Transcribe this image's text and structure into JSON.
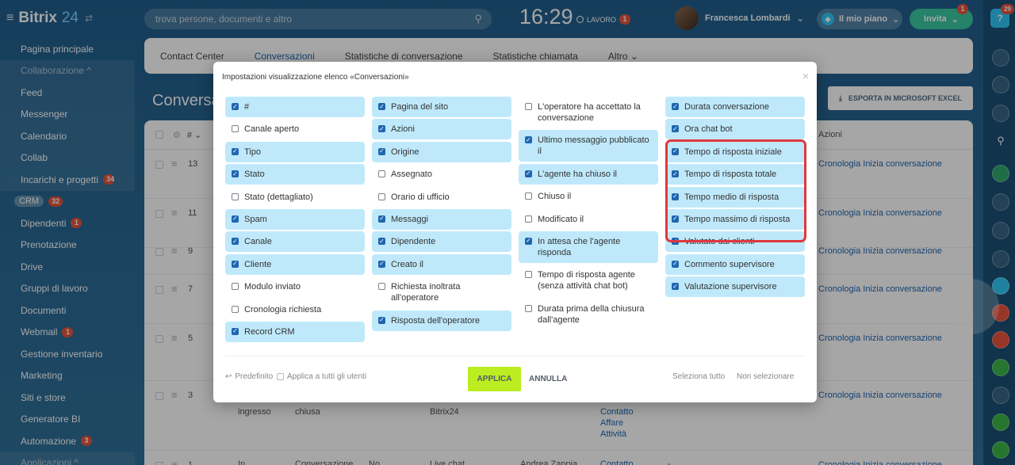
{
  "topbar": {
    "brand_main": "Bitrix",
    "brand_num": "24",
    "search_placeholder": "trova persone, documenti e altro",
    "clock": "16:29",
    "work_label": "LAVORO",
    "work_badge": "1",
    "user_name": "Francesca Lombardi",
    "plan_label": "Il mio piano",
    "invite_label": "Invita",
    "invite_badge": "1",
    "help_badge": "29"
  },
  "sidebar": {
    "items": [
      {
        "label": "Pagina principale"
      },
      {
        "label": "Collaborazione ^"
      },
      {
        "label": "Feed"
      },
      {
        "label": "Messenger"
      },
      {
        "label": "Calendario"
      },
      {
        "label": "Collab"
      },
      {
        "label": "Incarichi e progetti",
        "badge": "34"
      },
      {
        "label": "CRM",
        "badge": "32"
      },
      {
        "label": "Dipendenti",
        "badge": "1"
      },
      {
        "label": "Prenotazione"
      },
      {
        "label": "Drive"
      },
      {
        "label": "Gruppi di lavoro"
      },
      {
        "label": "Documenti"
      },
      {
        "label": "Webmail",
        "badge": "1"
      },
      {
        "label": "Gestione inventario"
      },
      {
        "label": "Marketing"
      },
      {
        "label": "Siti e store"
      },
      {
        "label": "Generatore BI"
      },
      {
        "label": "Automazione",
        "badge": "3"
      },
      {
        "label": "Applicazioni ^"
      }
    ]
  },
  "tabs": [
    "Contact Center",
    "Conversazioni",
    "Statistiche di conversazione",
    "Statistiche chiamata",
    "Altro ⌄"
  ],
  "page": {
    "title": "Conversa",
    "excel_button": "ESPORTA IN MICROSOFT EXCEL",
    "header_col_num": "# ⌄",
    "header_col_actions": "Azioni",
    "row_actions": "Cronologia Inizia conversazione",
    "rows": [
      {
        "num": "13"
      },
      {
        "num": "11"
      },
      {
        "num": "9"
      },
      {
        "num": "7"
      },
      {
        "num": "5"
      },
      {
        "num": "3",
        "c1": "ingresso",
        "c2": "chiusa",
        "c4": "Bitrix24",
        "links": "Contatto\nAffare\nAttività"
      },
      {
        "num": "1",
        "c1": "In",
        "c2": "Conversazione",
        "c3": "No",
        "c4": "Live chat",
        "c5": "Andrea Zappia",
        "links": "Contatto",
        "dash": "-"
      }
    ]
  },
  "modal": {
    "title": "Impostazioni visualizzazione elenco «Conversazioni»",
    "columns": [
      [
        {
          "label": "#",
          "checked": true
        },
        {
          "label": "Canale aperto",
          "checked": false
        },
        {
          "label": "Tipo",
          "checked": true
        },
        {
          "label": "Stato",
          "checked": true
        },
        {
          "label": "Stato (dettagliato)",
          "checked": false
        },
        {
          "label": "Spam",
          "checked": true
        },
        {
          "label": "Canale",
          "checked": true
        },
        {
          "label": "Cliente",
          "checked": true
        },
        {
          "label": "Modulo inviato",
          "checked": false
        },
        {
          "label": "Cronologia richiesta",
          "checked": false
        },
        {
          "label": "Record CRM",
          "checked": true
        }
      ],
      [
        {
          "label": "Pagina del sito",
          "checked": true
        },
        {
          "label": "Azioni",
          "checked": true
        },
        {
          "label": "Origine",
          "checked": true
        },
        {
          "label": "Assegnato",
          "checked": false
        },
        {
          "label": "Orario di ufficio",
          "checked": false
        },
        {
          "label": "Messaggi",
          "checked": true
        },
        {
          "label": "Dipendente",
          "checked": true
        },
        {
          "label": "Creato il",
          "checked": true
        },
        {
          "label": "Richiesta inoltrata all'operatore",
          "checked": false
        },
        {
          "label": "Risposta dell'operatore",
          "checked": true
        }
      ],
      [
        {
          "label": "L'operatore ha accettato la conversazione",
          "checked": false
        },
        {
          "label": "Ultimo messaggio pubblicato il",
          "checked": true
        },
        {
          "label": "L'agente ha chiuso il",
          "checked": true
        },
        {
          "label": "Chiuso il",
          "checked": false
        },
        {
          "label": "Modificato il",
          "checked": false
        },
        {
          "label": "In attesa che l'agente risponda",
          "checked": true
        },
        {
          "label": "Tempo di risposta agente (senza attività chat bot)",
          "checked": false
        },
        {
          "label": "Durata prima della chiusura dall'agente",
          "checked": false
        }
      ],
      [
        {
          "label": "Durata conversazione",
          "checked": true
        },
        {
          "label": "Ora chat bot",
          "checked": true
        },
        {
          "label": "Tempo di risposta iniziale",
          "checked": true
        },
        {
          "label": "Tempo di risposta totale",
          "checked": true
        },
        {
          "label": "Tempo medio di risposta",
          "checked": true
        },
        {
          "label": "Tempo massimo di risposta",
          "checked": true
        },
        {
          "label": "Valutato dai clienti",
          "checked": true
        },
        {
          "label": "Commento supervisore",
          "checked": true
        },
        {
          "label": "Valutazione supervisore",
          "checked": true
        }
      ]
    ],
    "default_label": "Predefinito",
    "apply_all_label": "Applica a tutti gli utenti",
    "apply_button": "APPLICA",
    "cancel_button": "ANNULLA",
    "select_all": "Seleziona tutto",
    "select_none": "Non selezionare"
  },
  "colors": {
    "accent": "#2066b0",
    "apply": "#bbed21",
    "highlight": "#e0373e",
    "checked_bg": "#bfe9fb"
  }
}
